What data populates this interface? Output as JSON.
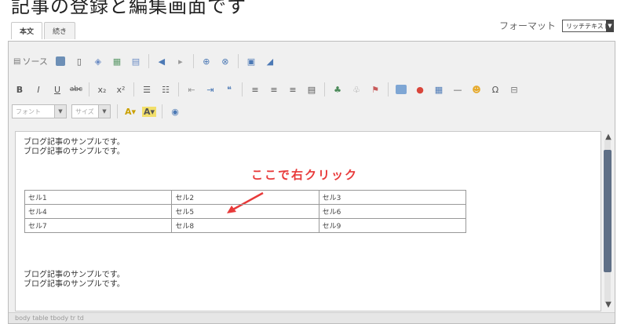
{
  "heading": "記事の登録と編集画面です",
  "tabs": [
    {
      "label": "本文",
      "active": true
    },
    {
      "label": "続き",
      "active": false
    }
  ],
  "format": {
    "label": "フォーマット",
    "value": "リッチテキスト"
  },
  "toolbar": {
    "source_label": "ソース",
    "font_combo_label": "フォント",
    "size_combo_label": "サイズ",
    "bold": "B",
    "italic": "I",
    "underline": "U",
    "strike": "abc",
    "sub": "x₂",
    "sup": "x²"
  },
  "content": {
    "para1_line1": "ブログ記事のサンプルです。",
    "para1_line2": "ブログ記事のサンプルです。",
    "callout": "ここで右クリック",
    "table": [
      [
        "セル1",
        "セル2",
        "セル3"
      ],
      [
        "セル4",
        "セル5",
        "セル6"
      ],
      [
        "セル7",
        "セル8",
        "セル9"
      ]
    ],
    "para2_line1": "ブログ記事のサンプルです。",
    "para2_line2": "ブログ記事のサンプルです。"
  },
  "status": "body table tbody tr td",
  "colors": {
    "callout": "#e83a3a",
    "scroll_thumb": "#5f6f86"
  }
}
